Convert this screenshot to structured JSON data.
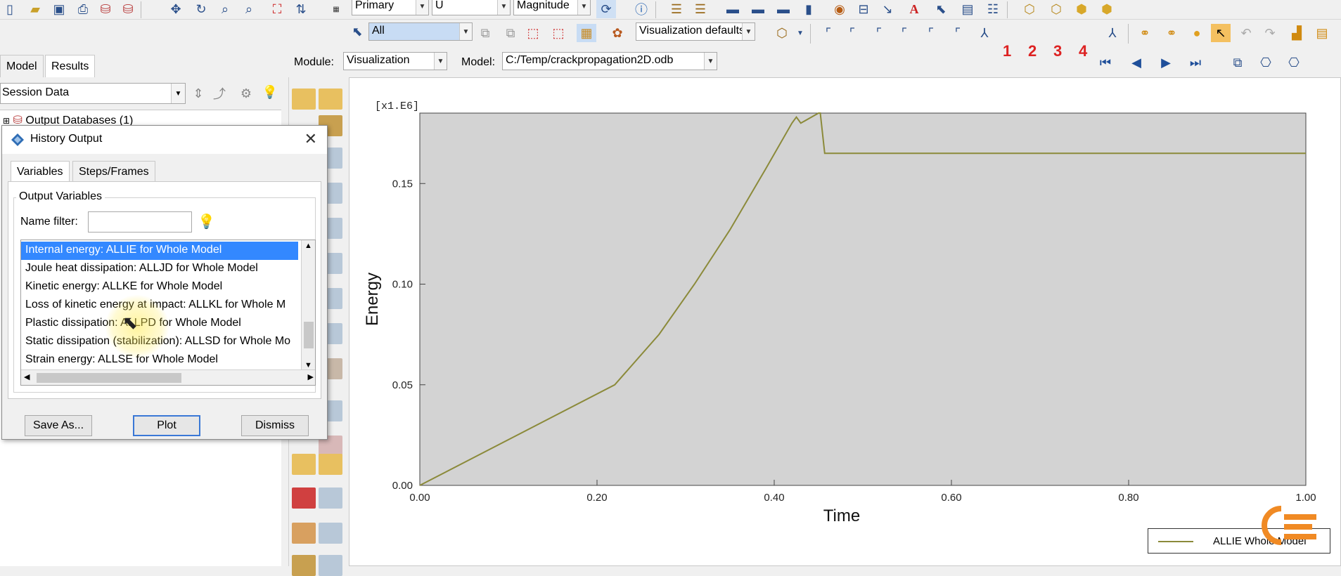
{
  "toolbar": {
    "primary": "Primary",
    "variable": "U",
    "magnitude": "Magnitude",
    "selection": "All",
    "viz_defaults": "Visualization defaults",
    "numbers": [
      "1",
      "2",
      "3",
      "4"
    ]
  },
  "module_bar": {
    "module_label": "Module:",
    "module_value": "Visualization",
    "model_label": "Model:",
    "model_value": "C:/Temp/crackpropagation2D.odb"
  },
  "left_panel": {
    "tabs": [
      "Model",
      "Results"
    ],
    "session": "Session Data",
    "tree_root": "Output Databases (1)"
  },
  "dialog": {
    "title": "History Output",
    "tabs": [
      "Variables",
      "Steps/Frames"
    ],
    "group": "Output Variables",
    "filter_label": "Name filter:",
    "filter_value": "",
    "items": [
      "Internal energy: ALLIE for Whole Model",
      "Joule heat dissipation: ALLJD for Whole Model",
      "Kinetic energy: ALLKE for Whole Model",
      "Loss of kinetic energy at impact: ALLKL for Whole M",
      "Plastic dissipation: ALLPD for Whole Model",
      "Static dissipation (stabilization): ALLSD for Whole Mo",
      "Strain energy: ALLSE for Whole Model"
    ],
    "selected_index": 0,
    "buttons": {
      "save_as": "Save As...",
      "plot": "Plot",
      "dismiss": "Dismiss"
    }
  },
  "chart_data": {
    "type": "line",
    "scale_label": "[x1.E6]",
    "xlabel": "Time",
    "ylabel": "Energy",
    "xlim": [
      0.0,
      1.0
    ],
    "ylim": [
      0.0,
      0.185
    ],
    "xticks": [
      "0.00",
      "0.20",
      "0.40",
      "0.60",
      "0.80",
      "1.00"
    ],
    "yticks": [
      "0.00",
      "0.05",
      "0.10",
      "0.15"
    ],
    "ytick_values": [
      0.0,
      0.05,
      0.1,
      0.15
    ],
    "xtick_values": [
      0.0,
      0.2,
      0.4,
      0.6,
      0.8,
      1.0
    ],
    "background": "#d3d3d3",
    "line_color": "#8b8a3a",
    "series": [
      {
        "name": "ALLIE Whole Model",
        "x": [
          0.0,
          0.22,
          0.27,
          0.31,
          0.35,
          0.39,
          0.42,
          0.425,
          0.43,
          0.45,
          0.452,
          0.457,
          1.0
        ],
        "y": [
          0.0,
          0.05,
          0.075,
          0.1,
          0.127,
          0.157,
          0.18,
          0.183,
          0.18,
          0.185,
          0.185,
          0.165,
          0.165
        ]
      }
    ],
    "legend_position": "bottom-right",
    "grid": false
  }
}
